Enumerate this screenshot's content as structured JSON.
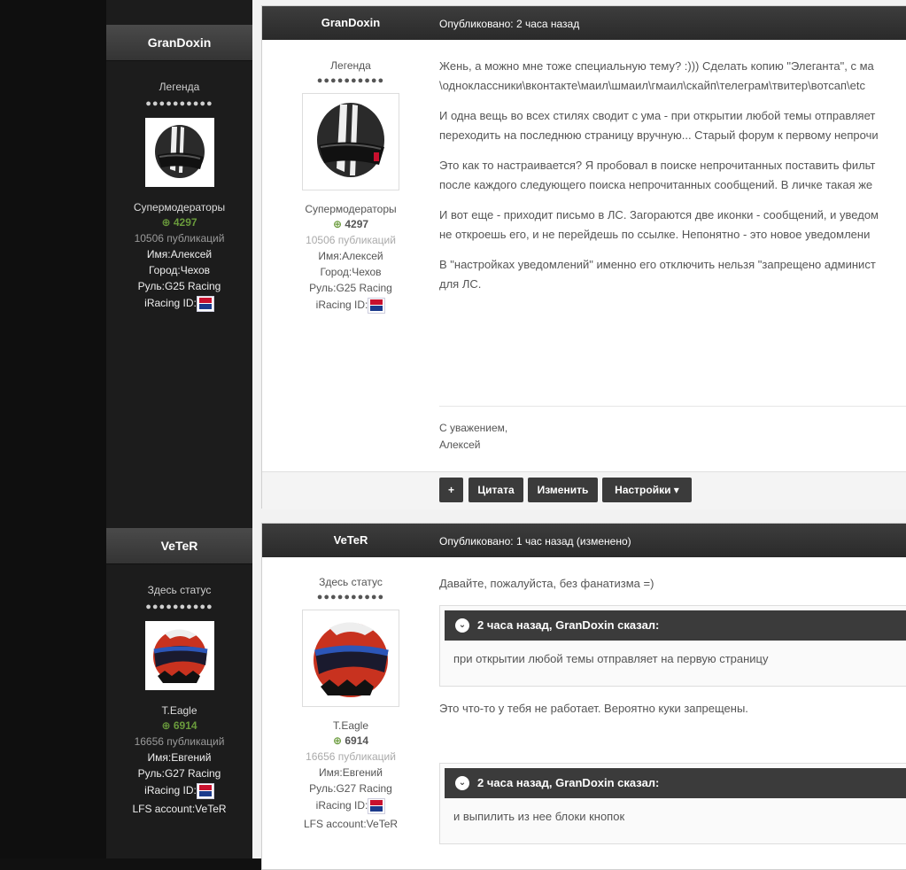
{
  "posts": [
    {
      "author": "GranDoxin",
      "date": "Опубликовано: 2 часа назад",
      "status": "Легенда",
      "dots": "●●●●●●●●●●",
      "group": "Супермодераторы",
      "rep": "4297",
      "posts_count": "10506 публикаций",
      "fields": [
        "Имя:Алексей",
        "Город:Чехов",
        "Руль:G25 Racing",
        "iRacing ID:"
      ],
      "body": [
        "Жень, а можно мне тоже специальную тему? :)))  Сделать копию \"Элеганта\", с ма",
        "\\одноклассники\\вконтакте\\маил\\шмаил\\гмаил\\скайп\\телеграм\\твитер\\вотсап\\etc",
        "И  одна вещь во всех стилях сводит с ума - при открытии любой темы отправляет",
        "переходить на последнюю страницу вручную... Старый форум к первому непрочи",
        "Это как то настраивается? Я пробовал в поиске непрочитанных поставить фильт",
        "после каждого следующего поиска непрочитанных сообщений. В личке такая же",
        "И вот еще - приходит письмо в ЛС. Загораются две иконки - сообщений, и уведом",
        "не откроешь его, и не перейдешь по ссылке.  Непонятно - это новое уведомлени",
        "В \"настройках уведомлений\" именно его отключить нельзя \"запрещено админист",
        "для ЛС."
      ],
      "signature": [
        "С уважением,",
        "Алексей"
      ],
      "actions": [
        "+",
        "Цитата",
        "Изменить",
        "Настройки ▾"
      ]
    },
    {
      "author": "VeTeR",
      "date": "Опубликовано: 1 час назад (изменено)",
      "status": "Здесь статус",
      "dots": "●●●●●●●●●●",
      "group": "T.Eagle",
      "rep": "6914",
      "posts_count": "16656 публикаций",
      "fields": [
        "Имя:Евгений",
        "Руль:G27 Racing",
        "iRacing ID:",
        "LFS account:VeTeR"
      ],
      "body_intro": "Давайте, пожалуйста, без фанатизма =)",
      "quote1_head": "2 часа назад, GranDoxin сказал:",
      "quote1_body": "при открытии любой темы отправляет на первую страницу",
      "body_mid": "Это что-то у тебя не работает. Вероятно куки запрещены.",
      "quote2_head": "2 часа назад, GranDoxin сказал:",
      "quote2_body": "и выпилить из нее блоки кнопок"
    }
  ],
  "sidebar": [
    {
      "name": "GranDoxin",
      "status": "Легенда",
      "dots": "●●●●●●●●●●",
      "group": "Супермодераторы",
      "rep": "4297",
      "posts_count": "10506 публикаций",
      "fields": [
        "Имя:Алексей",
        "Город:Чехов",
        "Руль:G25 Racing",
        "iRacing ID:"
      ]
    },
    {
      "name": "VeTeR",
      "status": "Здесь статус",
      "dots": "●●●●●●●●●●",
      "group": "T.Eagle",
      "rep": "6914",
      "posts_count": "16656 публикаций",
      "fields": [
        "Имя:Евгений",
        "Руль:G27 Racing",
        "iRacing ID:",
        "LFS account:VeTeR"
      ]
    }
  ],
  "colors": {
    "header_dark": "#2f2f2f",
    "rep_green": "#6a9b3c",
    "sidebar_bg": "#1c1c1c"
  }
}
